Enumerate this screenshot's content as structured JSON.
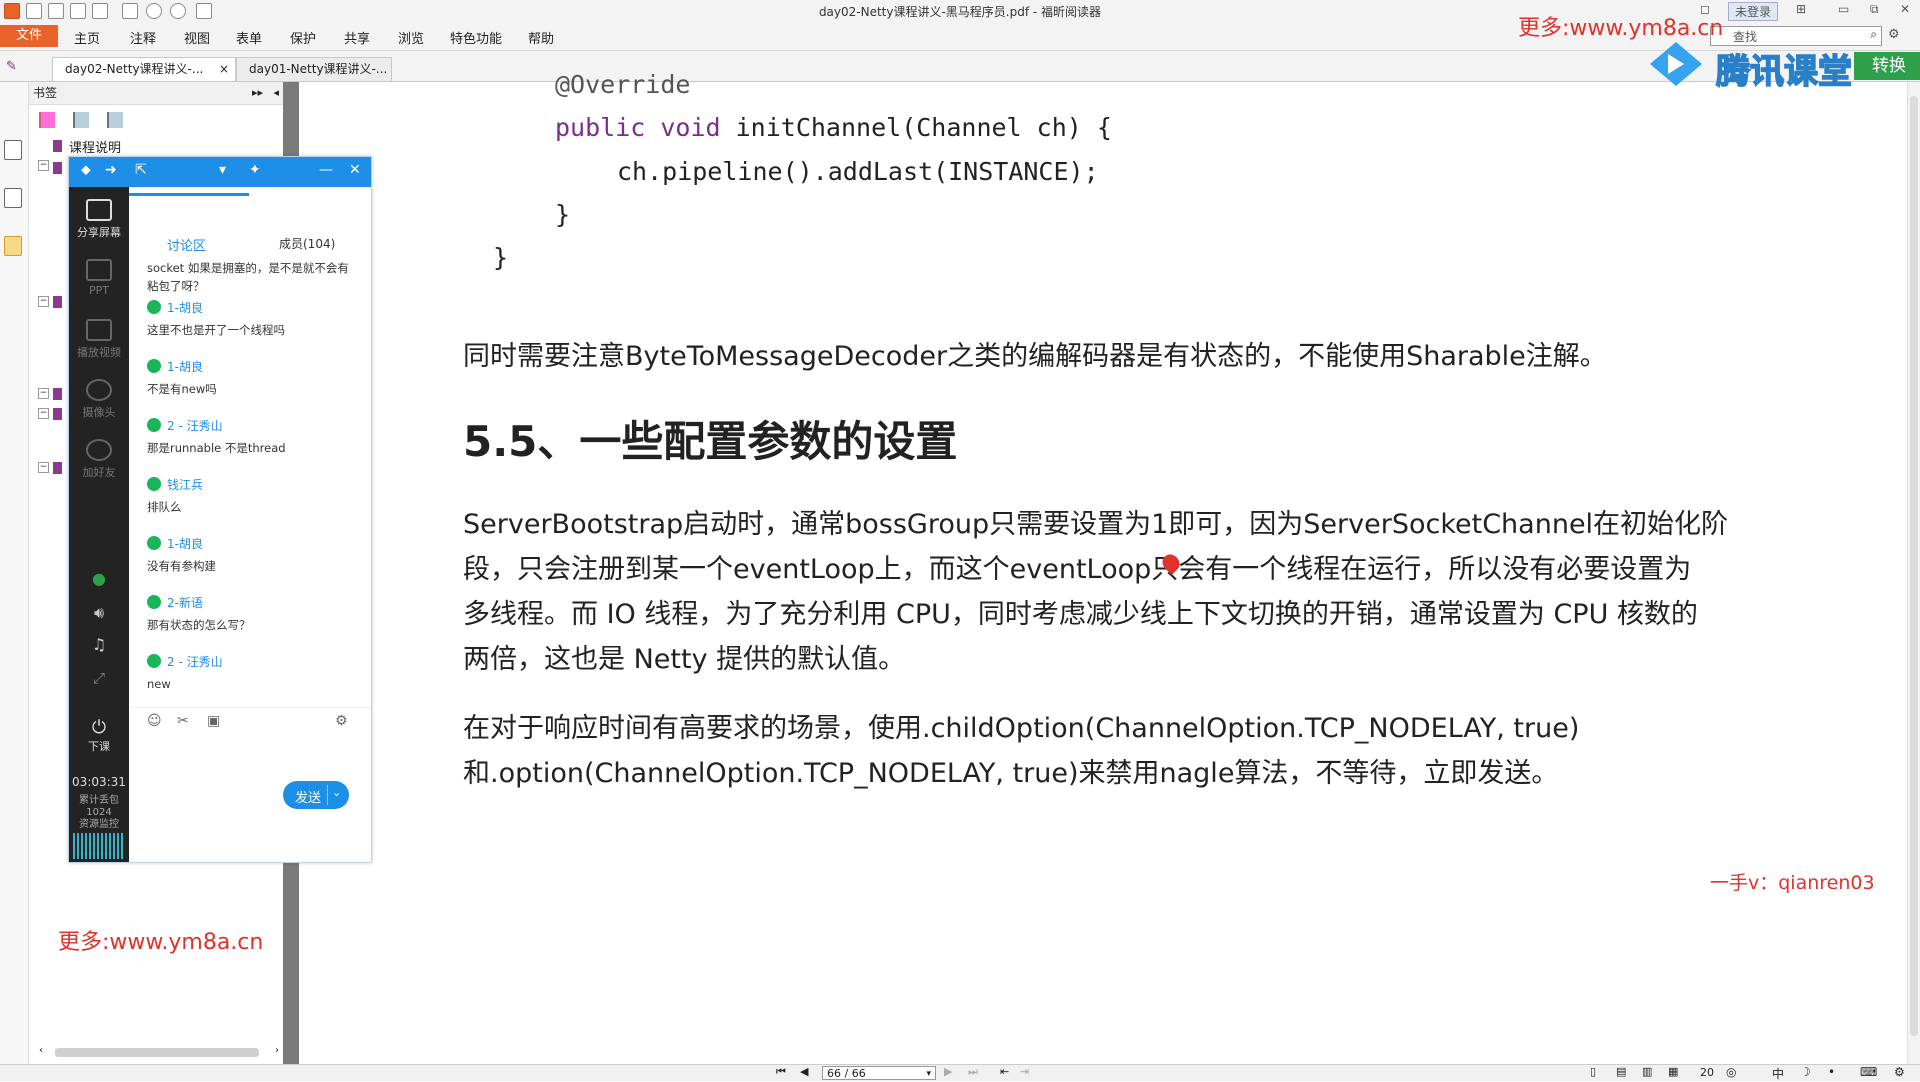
{
  "window": {
    "title": "day02-Netty课程讲义-黑马程序员.pdf - 福昕阅读器",
    "login_label": "未登录",
    "search_placeholder": "查找"
  },
  "menu": {
    "file": "文件",
    "items": [
      "主页",
      "注释",
      "视图",
      "表单",
      "保护",
      "共享",
      "浏览",
      "特色功能",
      "帮助"
    ]
  },
  "tabs": [
    {
      "label": "day02-Netty课程讲义-...",
      "close": "×"
    },
    {
      "label": "day01-Netty课程讲义-..."
    }
  ],
  "bookmarks": {
    "header": "书签",
    "first_item": "课程说明"
  },
  "document": {
    "code": {
      "line1": "@Override",
      "line2_kw": "public void",
      "line2_rest": " initChannel(Channel ch) {",
      "line3": "ch.pipeline().addLast(INSTANCE);",
      "line4": "}",
      "line5": "}"
    },
    "para_sharable": "同时需要注意ByteToMessageDecoder之类的编解码器是有状态的，不能使用Sharable注解。",
    "heading": "5.5、一些配置参数的设置",
    "para1": [
      "ServerBootstrap启动时，通常bossGroup只需要设置为1即可，因为ServerSocketChannel在初始化阶",
      "段，只会注册到某一个eventLoop上，而这个eventLoop只会有一个线程在运行，所以没有必要设置为",
      "多线程。而 IO 线程，为了充分利用 CPU，同时考虑减少线上下文切换的开销，通常设置为 CPU 核数的",
      "两倍，这也是 Netty 提供的默认值。"
    ],
    "para2": [
      "在对于响应时间有高要求的场景，使用.childOption(ChannelOption.TCP_NODELAY, true)",
      "和.option(ChannelOption.TCP_NODELAY, true)来禁用nagle算法，不等待，立即发送。"
    ]
  },
  "chat": {
    "side_buttons": [
      "分享屏幕",
      "PPT",
      "播放视频",
      "摄像头",
      "加好友"
    ],
    "end_class": "下课",
    "timer": "03:03:31",
    "lost_packets_label": "累计丢包",
    "lost_packets_value": "1024",
    "resource_label": "资源监控",
    "tab_discussion": "讨论区",
    "tab_members": "成员(104)",
    "first_message": "socket 如果是拥塞的，是不是就不会有 粘包了呀？",
    "messages": [
      {
        "name": "1-胡良",
        "text": "这里不也是开了一个线程吗"
      },
      {
        "name": "1-胡良",
        "text": "不是有new吗"
      },
      {
        "name": "2 - 汪秀山",
        "text": "那是runnable  不是thread"
      },
      {
        "name": "钱江兵",
        "text": "排队么"
      },
      {
        "name": "1-胡良",
        "text": "没有有参构建"
      },
      {
        "name": "2-新语",
        "text": "那有状态的怎么写？"
      },
      {
        "name": "2 - 汪秀山",
        "text": "new"
      }
    ],
    "send_label": "发送"
  },
  "watermarks": {
    "top_right": "更多:www.ym8a.cn",
    "left": "更多:www.ym8a.cn",
    "bottom_right": "一手v：qianren03",
    "tencent": "腾讯课堂",
    "convert_suffix": "转换"
  },
  "status": {
    "page_indicator": "66 / 66",
    "zoom_fragment": "20"
  },
  "colors": {
    "accent": "#1e8fe6",
    "file_menu": "#e8622a",
    "watermark_red": "#e0322a",
    "code_keyword": "#7b2e8c",
    "online_green": "#19b55a"
  }
}
